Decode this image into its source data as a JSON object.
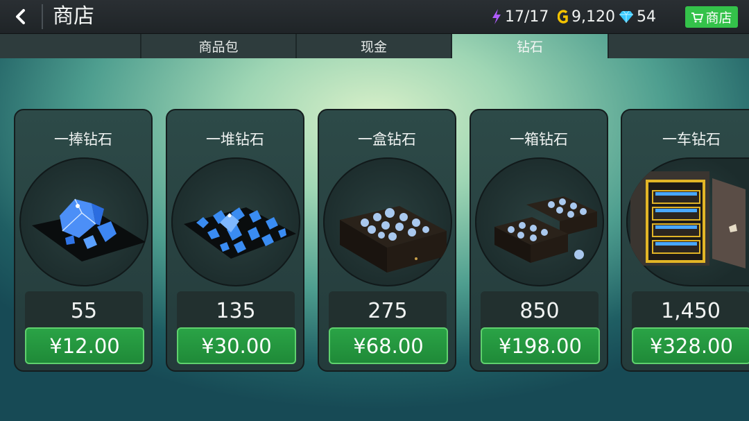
{
  "header": {
    "title": "商店",
    "energy": "17/17",
    "gold": "9,120",
    "gems": "54",
    "shop_label": "商店"
  },
  "tabs": [
    {
      "label": "商品包",
      "active": false
    },
    {
      "label": "现金",
      "active": false
    },
    {
      "label": "钻石",
      "active": true
    }
  ],
  "products": [
    {
      "title": "一捧钻石",
      "amount": "55",
      "price": "¥12.00",
      "icon": "gem-handful"
    },
    {
      "title": "一堆钻石",
      "amount": "135",
      "price": "¥30.00",
      "icon": "gem-pile"
    },
    {
      "title": "一盒钻石",
      "amount": "275",
      "price": "¥68.00",
      "icon": "gem-box"
    },
    {
      "title": "一箱钻石",
      "amount": "850",
      "price": "¥198.00",
      "icon": "gem-crate"
    },
    {
      "title": "一车钻石",
      "amount": "1,450",
      "price": "¥328.00",
      "icon": "gem-safe"
    }
  ],
  "colors": {
    "accent_green": "#34c24a",
    "energy": "#b05cff",
    "gold": "#f2c200",
    "gem": "#38c8ff"
  }
}
